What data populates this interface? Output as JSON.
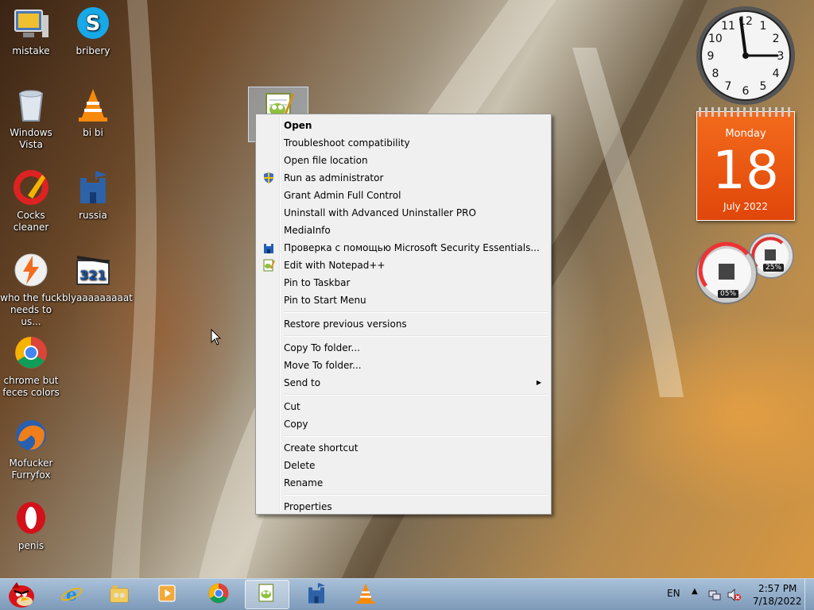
{
  "desktop": {
    "icons": [
      {
        "label": "mistake",
        "icon": "computer-icon"
      },
      {
        "label": "bribery",
        "icon": "skype-icon"
      },
      {
        "label": "Windows Vista",
        "icon": "recycle-bin-icon"
      },
      {
        "label": "bi bi",
        "icon": "vlc-icon"
      },
      {
        "label": "Cocks cleaner",
        "icon": "ccleaner-icon"
      },
      {
        "label": "russia",
        "icon": "castle-icon"
      },
      {
        "label": "who the fuck needs to us...",
        "icon": "lightning-icon"
      },
      {
        "label": "blyaaaaaaaaat",
        "icon": "media-player-classic-icon"
      },
      {
        "label": "chrome but feces colors",
        "icon": "chrome-icon"
      },
      {
        "label": "Mofucker Furryfox",
        "icon": "firefox-icon"
      },
      {
        "label": "penis",
        "icon": "opera-icon"
      }
    ]
  },
  "gadgets": {
    "clock": {
      "numbers": [
        "12",
        "1",
        "2",
        "3",
        "4",
        "5",
        "6",
        "7",
        "8",
        "9",
        "10",
        "11"
      ]
    },
    "calendar": {
      "weekday": "Monday",
      "day": "18",
      "month_year": "July 2022"
    },
    "cpu_meter": {
      "cpu": "05%",
      "ram": "25%"
    }
  },
  "context_menu": {
    "items": [
      {
        "label": "Open",
        "bold": true
      },
      {
        "label": "Troubleshoot compatibility"
      },
      {
        "label": "Open file location"
      },
      {
        "label": "Run as administrator",
        "icon": "shield-icon"
      },
      {
        "label": "Grant Admin Full Control"
      },
      {
        "label": "Uninstall with Advanced Uninstaller PRO"
      },
      {
        "label": "MediaInfo"
      },
      {
        "label": "Проверка с помощью Microsoft Security Essentials...",
        "icon": "security-essentials-icon"
      },
      {
        "label": "Edit with Notepad++",
        "icon": "notepad-plus-icon"
      },
      {
        "label": "Pin to Taskbar"
      },
      {
        "label": "Pin to Start Menu"
      },
      {
        "separator": true
      },
      {
        "label": "Restore previous versions"
      },
      {
        "separator": true
      },
      {
        "label": "Copy To folder..."
      },
      {
        "label": "Move To folder..."
      },
      {
        "label": "Send to",
        "submenu": true
      },
      {
        "separator": true
      },
      {
        "label": "Cut"
      },
      {
        "label": "Copy"
      },
      {
        "separator": true
      },
      {
        "label": "Create shortcut"
      },
      {
        "label": "Delete"
      },
      {
        "label": "Rename"
      },
      {
        "separator": true
      },
      {
        "label": "Properties"
      }
    ]
  },
  "taskbar": {
    "apps": [
      "angry-birds-icon",
      "internet-explorer-icon",
      "libraries-icon",
      "media-player-icon",
      "chrome-icon",
      "notepad-plus-icon",
      "castle-icon",
      "vlc-icon"
    ],
    "language": "EN",
    "time": "2:57 PM",
    "date": "7/18/2022"
  }
}
